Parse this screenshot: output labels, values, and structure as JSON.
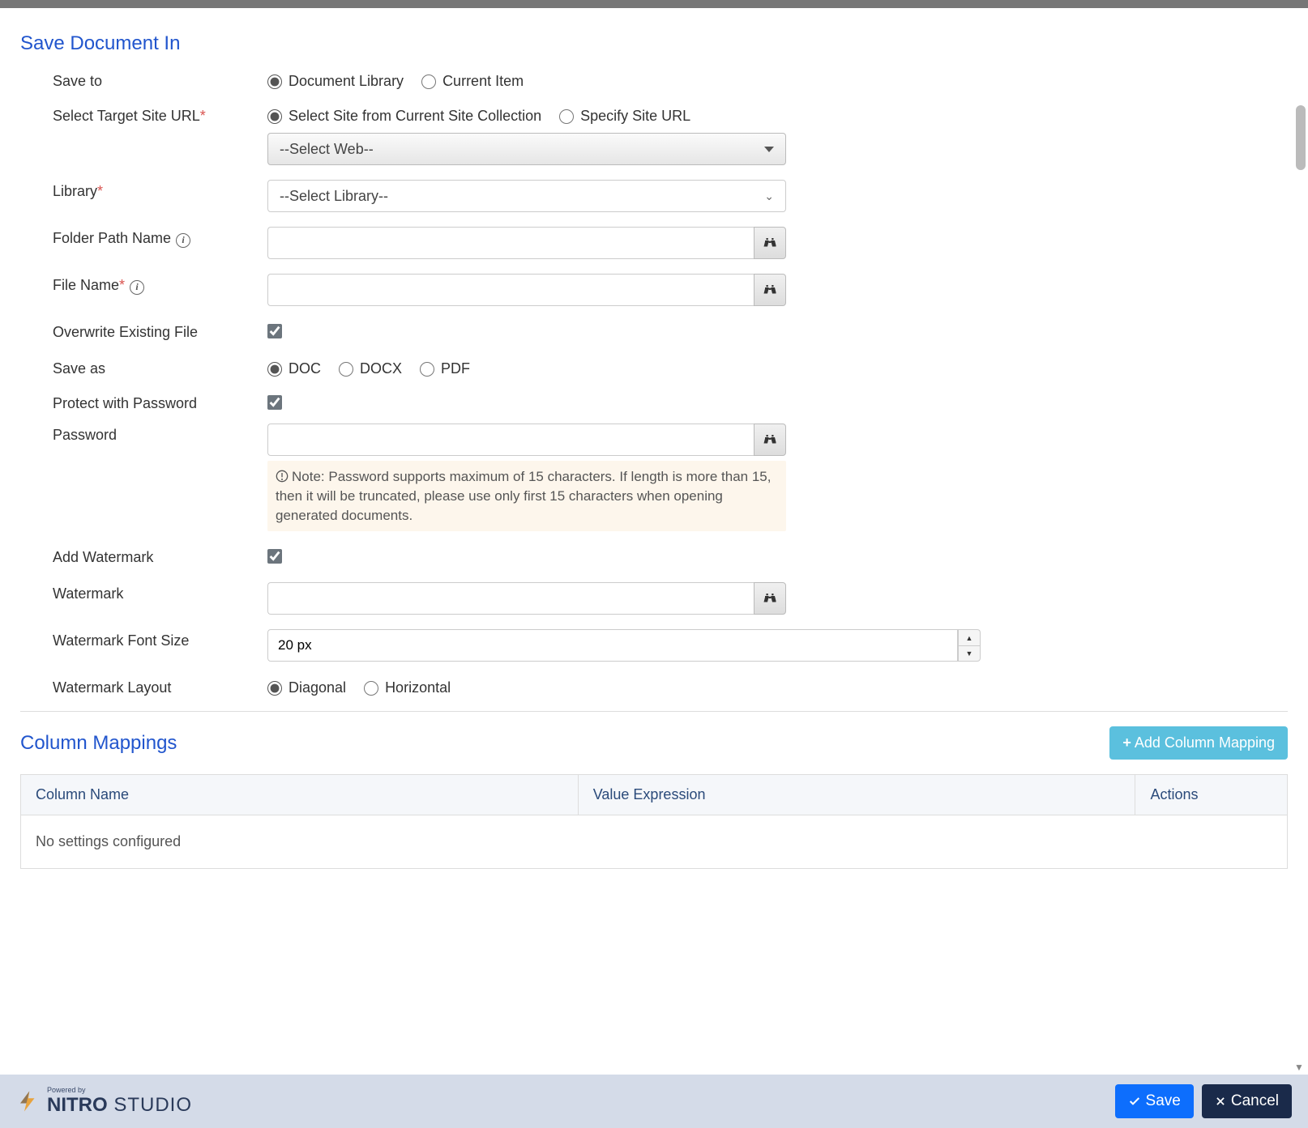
{
  "sections": {
    "saveDoc": "Save Document In",
    "columnMap": "Column Mappings"
  },
  "labels": {
    "saveTo": "Save to",
    "targetUrl": "Select Target Site URL",
    "library": "Library",
    "folderPath": "Folder Path Name",
    "fileName": "File Name",
    "overwrite": "Overwrite Existing File",
    "saveAs": "Save as",
    "protect": "Protect with Password",
    "password": "Password",
    "addWatermark": "Add Watermark",
    "watermark": "Watermark",
    "wmFontSize": "Watermark Font Size",
    "wmLayout": "Watermark Layout"
  },
  "radios": {
    "saveTo": {
      "docLib": "Document Library",
      "curItem": "Current Item",
      "selected": "docLib"
    },
    "target": {
      "fromCollection": "Select Site from Current Site Collection",
      "specify": "Specify Site URL",
      "selected": "fromCollection"
    },
    "saveAs": {
      "doc": "DOC",
      "docx": "DOCX",
      "pdf": "PDF",
      "selected": "doc"
    },
    "layout": {
      "diagonal": "Diagonal",
      "horizontal": "Horizontal",
      "selected": "diagonal"
    }
  },
  "selects": {
    "web": "--Select Web--",
    "library": "--Select Library--"
  },
  "values": {
    "folderPath": "",
    "fileName": "",
    "password": "",
    "watermark": "",
    "fontSize": "20 px",
    "overwrite": true,
    "protect": true,
    "addWatermark": true
  },
  "note": "Note: Password supports maximum of 15 characters. If length is more than 15, then it will be truncated, please use only first 15 characters when opening generated documents.",
  "buttons": {
    "addMapping": "Add Column Mapping",
    "save": "Save",
    "cancel": "Cancel"
  },
  "table": {
    "headers": {
      "col": "Column Name",
      "val": "Value Expression",
      "act": "Actions"
    },
    "empty": "No settings configured"
  },
  "brand": {
    "powered": "Powered by",
    "name1": "NITRO",
    "name2": " STUDIO"
  }
}
